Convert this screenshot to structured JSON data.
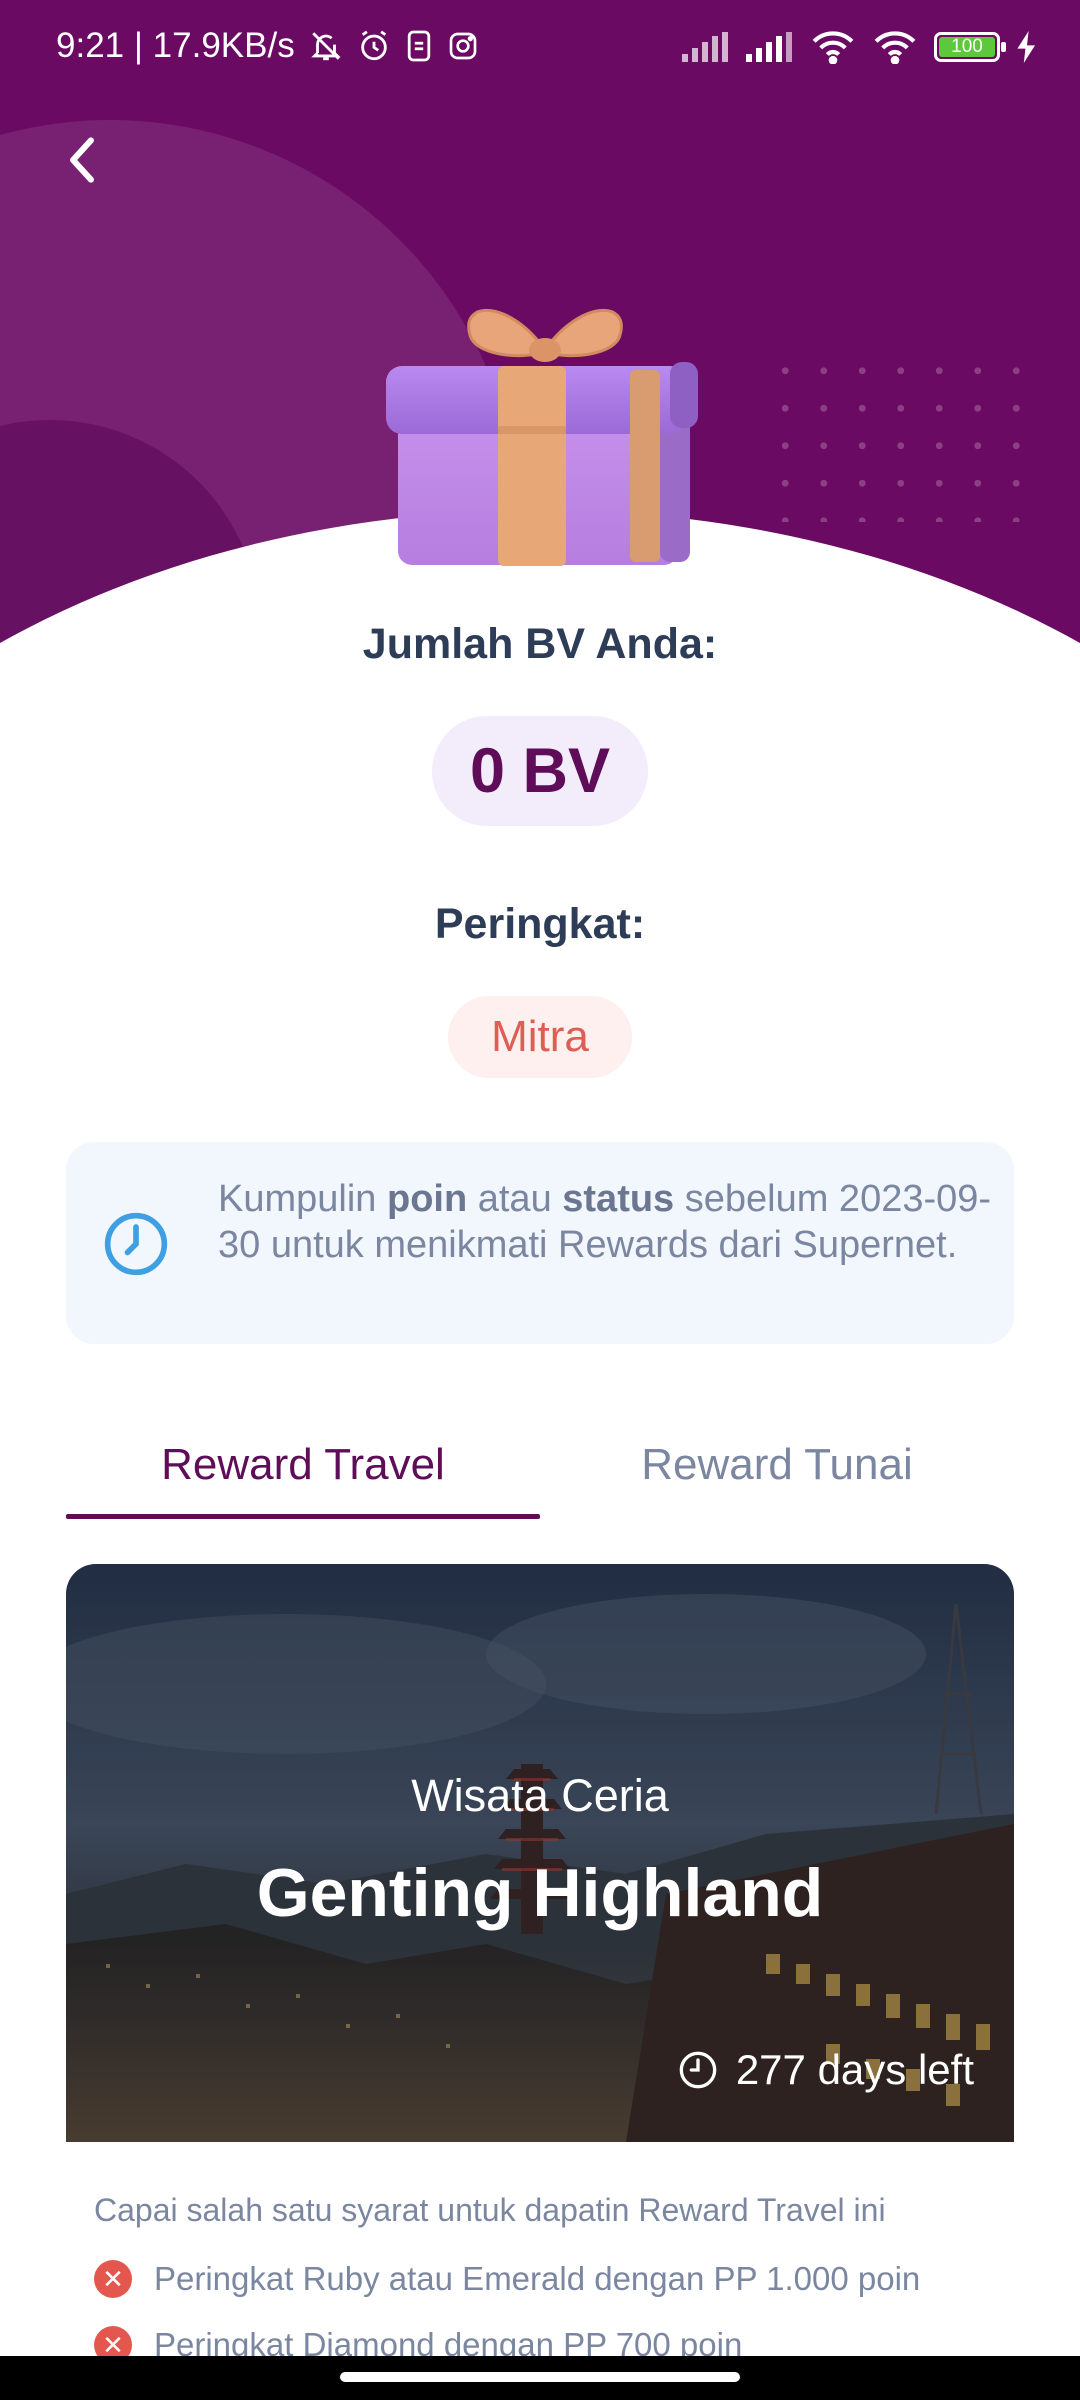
{
  "status_bar": {
    "time_speed": "9:21 | 17.9KB/s",
    "battery": "100",
    "icons": [
      "bell-off-icon",
      "alarm-icon",
      "sim-icon",
      "instagram-icon",
      "signal-icon",
      "signal-icon",
      "wifi-icon",
      "wifi-icon",
      "battery-icon",
      "charging-icon"
    ]
  },
  "header": {
    "back_icon": "chevron-left-icon",
    "gift_icon": "gift-box-icon"
  },
  "bv": {
    "label": "Jumlah BV Anda:",
    "value": "0 BV"
  },
  "rank": {
    "label": "Peringkat:",
    "value": "Mitra"
  },
  "info": {
    "icon": "clock-icon",
    "text_1": "Kumpulin ",
    "bold_1": "poin",
    "text_2": " atau ",
    "bold_2": "status",
    "text_3": " sebelum 2023-09-30 untuk menikmati Rewards dari Supernet."
  },
  "tabs": [
    {
      "label": "Reward Travel",
      "active": true
    },
    {
      "label": "Reward Tunai",
      "active": false
    }
  ],
  "card": {
    "subtitle": "Wisata Ceria",
    "title": "Genting Highland",
    "days_left": "277 days left"
  },
  "requirements": {
    "title": "Capai salah satu syarat untuk dapatin Reward Travel ini",
    "items": [
      "Peringkat Ruby atau Emerald dengan PP 1.000 poin",
      "Peringkat Diamond dengan PP 700 poin"
    ]
  },
  "colors": {
    "brand_purple": "#6a0a63",
    "accent_red": "#de5d55",
    "info_bg": "#f1f7fd",
    "clock_blue": "#3ea0e3"
  }
}
